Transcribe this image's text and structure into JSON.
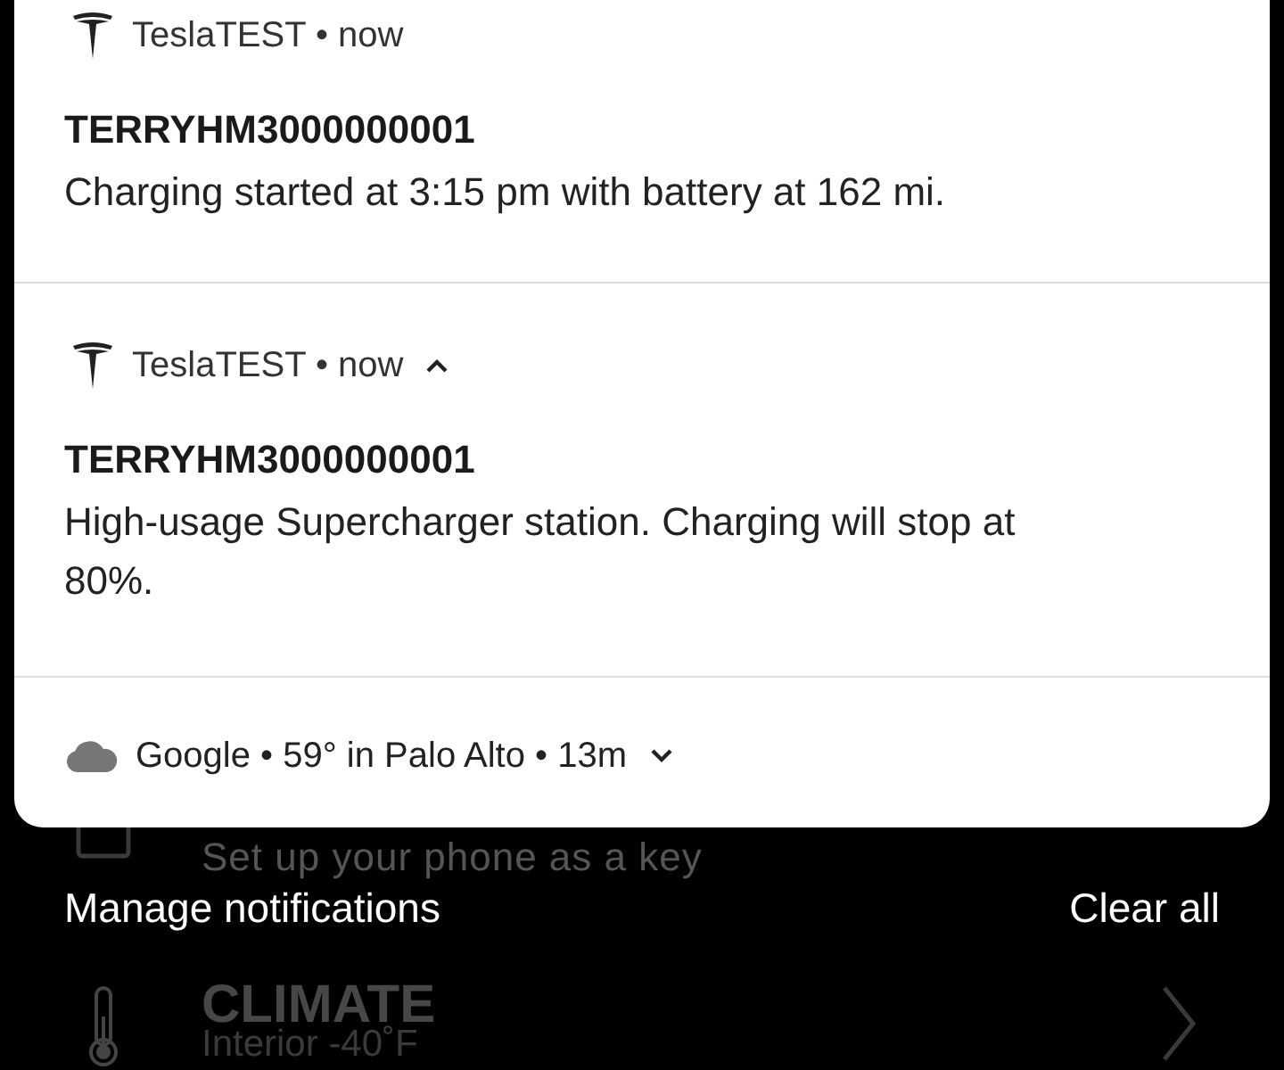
{
  "notifications": [
    {
      "kind": "full",
      "header": "TeslaTEST • now",
      "title": "TERRYHM3000000001",
      "body": "Charging started at 3:15 pm with battery at 162 mi."
    },
    {
      "kind": "full",
      "header": "TeslaTEST • now",
      "expanded": true,
      "title": "TERRYHM3000000001",
      "body": "High-usage Supercharger station. Charging will stop at 80%."
    },
    {
      "kind": "compact",
      "header": "Google • 59° in Palo Alto • 13m",
      "expanded": false
    }
  ],
  "footer": {
    "manage": "Manage notifications",
    "clear": "Clear all"
  },
  "background_app": {
    "key_row": "Set up your phone as a key",
    "climate_title": "CLIMATE",
    "climate_subtitle": "Interior -40˚F"
  }
}
